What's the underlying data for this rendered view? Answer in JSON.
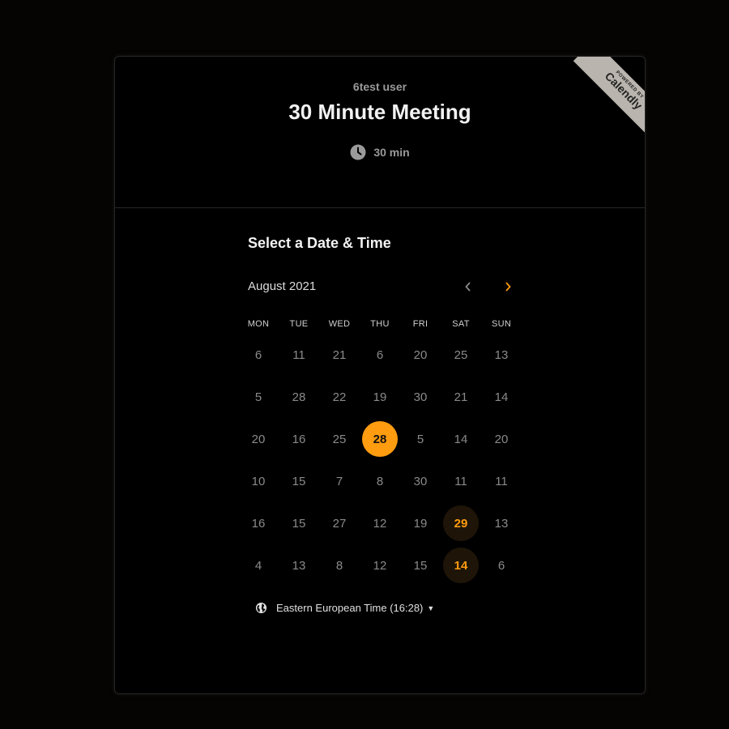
{
  "header": {
    "host_name": "6test user",
    "event_title": "30 Minute Meeting",
    "duration": "30 min",
    "ribbon_small": "POWERED BY",
    "ribbon_brand": "Calendly"
  },
  "calendar": {
    "section_title": "Select a Date & Time",
    "month_label": "August 2021",
    "prev_icon": "chevron-left-icon",
    "next_icon": "chevron-right-icon",
    "weekdays": [
      "MON",
      "TUE",
      "WED",
      "THU",
      "FRI",
      "SAT",
      "SUN"
    ],
    "weeks": [
      [
        "6",
        "11",
        "21",
        "6",
        "20",
        "25",
        "13"
      ],
      [
        "5",
        "28",
        "22",
        "19",
        "30",
        "21",
        "14"
      ],
      [
        "20",
        "16",
        "25",
        "28",
        "5",
        "14",
        "20"
      ],
      [
        "10",
        "15",
        "7",
        "8",
        "30",
        "11",
        "11"
      ],
      [
        "16",
        "15",
        "27",
        "12",
        "19",
        "29",
        "13"
      ],
      [
        "4",
        "13",
        "8",
        "12",
        "15",
        "14",
        "6"
      ]
    ],
    "selected": {
      "week": 2,
      "day": 3
    },
    "available": [
      {
        "week": 4,
        "day": 5
      },
      {
        "week": 5,
        "day": 5
      }
    ]
  },
  "timezone": {
    "label": "Eastern European Time (16:28)",
    "icon": "globe-icon"
  },
  "colors": {
    "accent": "#ff9c10",
    "background": "#000000",
    "muted_text": "#8a8a8a"
  }
}
